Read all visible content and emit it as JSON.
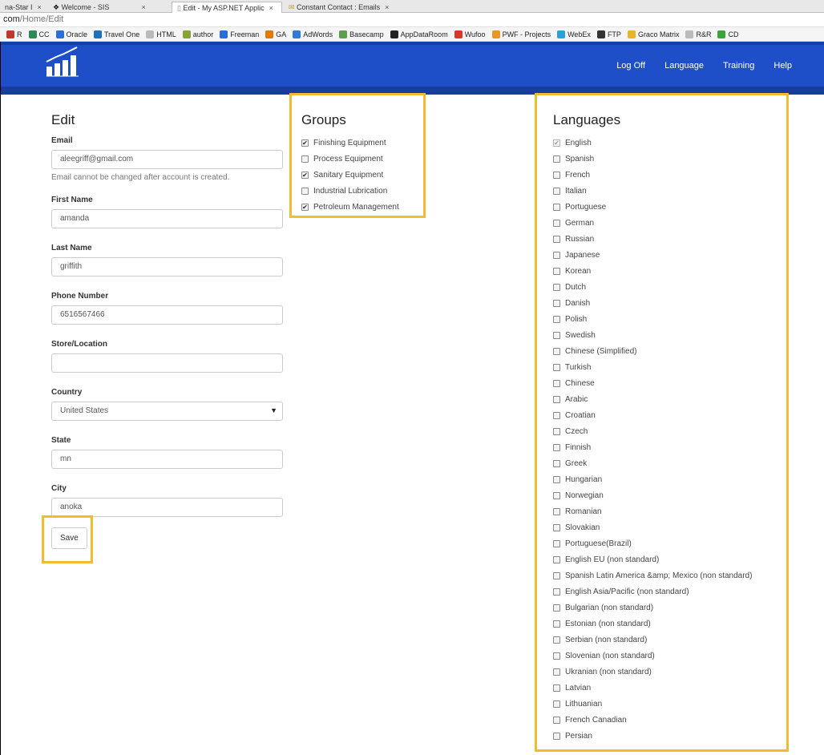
{
  "browser": {
    "tabs": [
      {
        "label": "na-Star I",
        "active": false
      },
      {
        "label": "Welcome - SIS",
        "active": false
      },
      {
        "label": "Edit - My ASP.NET Applic",
        "active": true
      },
      {
        "label": "Constant Contact : Emails",
        "active": false
      }
    ],
    "url_host": "com",
    "url_path": "/Home/Edit",
    "bookmarks": [
      {
        "label": "R",
        "color": "#c0392b"
      },
      {
        "label": "CC",
        "color": "#2e8b57"
      },
      {
        "label": "Oracle",
        "color": "#2a6fd6"
      },
      {
        "label": "Travel One",
        "color": "#1f6fbf"
      },
      {
        "label": "HTML",
        "color": "#bbbbbb"
      },
      {
        "label": "author",
        "color": "#8aa23a"
      },
      {
        "label": "Freeman",
        "color": "#2a6fd6"
      },
      {
        "label": "GA",
        "color": "#e07b00"
      },
      {
        "label": "AdWords",
        "color": "#2f7bd8"
      },
      {
        "label": "Basecamp",
        "color": "#5aa04a"
      },
      {
        "label": "AppDataRoom",
        "color": "#222222"
      },
      {
        "label": "Wufoo",
        "color": "#d9362a"
      },
      {
        "label": "PWF - Projects",
        "color": "#e8962a"
      },
      {
        "label": "WebEx",
        "color": "#2aa1d8"
      },
      {
        "label": "FTP",
        "color": "#333333"
      },
      {
        "label": "Graco Matrix",
        "color": "#e8b52a"
      },
      {
        "label": "R&R",
        "color": "#bbbbbb"
      },
      {
        "label": "CD",
        "color": "#3aa33a"
      }
    ]
  },
  "nav": {
    "links": [
      "Log Off",
      "Language",
      "Training",
      "Help"
    ]
  },
  "form": {
    "title": "Edit",
    "email_label": "Email",
    "email_value": "aleegriff@gmail.com",
    "email_help": "Email cannot be changed after account is created.",
    "first_name_label": "First Name",
    "first_name_value": "amanda",
    "last_name_label": "Last Name",
    "last_name_value": "griffith",
    "phone_label": "Phone Number",
    "phone_value": "6516567466",
    "store_label": "Store/Location",
    "store_value": "",
    "country_label": "Country",
    "country_value": "United States",
    "state_label": "State",
    "state_value": "mn",
    "city_label": "City",
    "city_value": "anoka",
    "save_label": "Save"
  },
  "groups": {
    "title": "Groups",
    "items": [
      {
        "label": "Finishing Equipment",
        "checked": true
      },
      {
        "label": "Process Equipment",
        "checked": false
      },
      {
        "label": "Sanitary Equipment",
        "checked": true
      },
      {
        "label": "Industrial Lubrication",
        "checked": false
      },
      {
        "label": "Petroleum Management",
        "checked": true
      }
    ]
  },
  "languages": {
    "title": "Languages",
    "items": [
      {
        "label": "English",
        "checked": true,
        "disabled": true
      },
      {
        "label": "Spanish",
        "checked": false
      },
      {
        "label": "French",
        "checked": false
      },
      {
        "label": "Italian",
        "checked": false
      },
      {
        "label": "Portuguese",
        "checked": false
      },
      {
        "label": "German",
        "checked": false
      },
      {
        "label": "Russian",
        "checked": false
      },
      {
        "label": "Japanese",
        "checked": false
      },
      {
        "label": "Korean",
        "checked": false
      },
      {
        "label": "Dutch",
        "checked": false
      },
      {
        "label": "Danish",
        "checked": false
      },
      {
        "label": "Polish",
        "checked": false
      },
      {
        "label": "Swedish",
        "checked": false
      },
      {
        "label": "Chinese (Simplified)",
        "checked": false
      },
      {
        "label": "Turkish",
        "checked": false
      },
      {
        "label": "Chinese",
        "checked": false
      },
      {
        "label": "Arabic",
        "checked": false
      },
      {
        "label": "Croatian",
        "checked": false
      },
      {
        "label": "Czech",
        "checked": false
      },
      {
        "label": "Finnish",
        "checked": false
      },
      {
        "label": "Greek",
        "checked": false
      },
      {
        "label": "Hungarian",
        "checked": false
      },
      {
        "label": "Norwegian",
        "checked": false
      },
      {
        "label": "Romanian",
        "checked": false
      },
      {
        "label": "Slovakian",
        "checked": false
      },
      {
        "label": "Portuguese(Brazil)",
        "checked": false
      },
      {
        "label": "English EU (non standard)",
        "checked": false
      },
      {
        "label": "Spanish Latin America &amp; Mexico (non standard)",
        "checked": false
      },
      {
        "label": "English Asia/Pacific (non standard)",
        "checked": false
      },
      {
        "label": "Bulgarian (non standard)",
        "checked": false
      },
      {
        "label": "Estonian (non standard)",
        "checked": false
      },
      {
        "label": "Serbian (non standard)",
        "checked": false
      },
      {
        "label": "Slovenian (non standard)",
        "checked": false
      },
      {
        "label": "Ukranian (non standard)",
        "checked": false
      },
      {
        "label": "Latvian",
        "checked": false
      },
      {
        "label": "Lithuanian",
        "checked": false
      },
      {
        "label": "French Canadian",
        "checked": false
      },
      {
        "label": "Persian",
        "checked": false
      }
    ]
  },
  "colors": {
    "navbar": "#1e4fc8",
    "highlight": "#f5b934"
  }
}
